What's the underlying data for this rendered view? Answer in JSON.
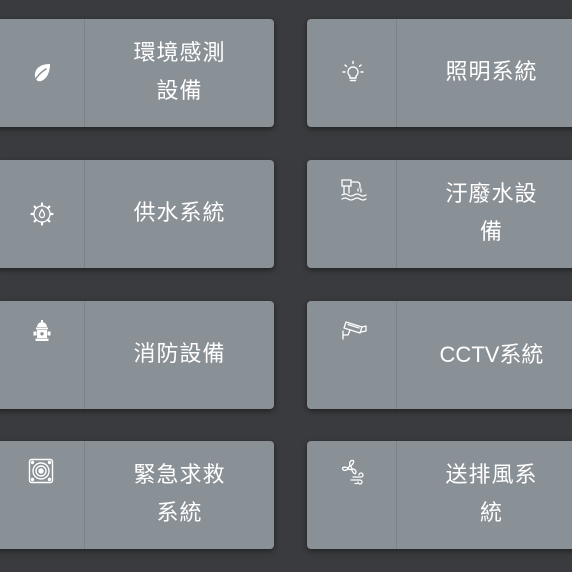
{
  "tiles": [
    {
      "id": "env",
      "label": "環境感測\n設備",
      "icon": "leaf-icon"
    },
    {
      "id": "light",
      "label": "照明系統",
      "icon": "lightbulb-icon"
    },
    {
      "id": "water",
      "label": "供水系統",
      "icon": "water-gear-icon"
    },
    {
      "id": "sewage",
      "label": "汙廢水設\n備",
      "icon": "sewage-pipe-icon"
    },
    {
      "id": "fire",
      "label": "消防設備",
      "icon": "fire-hydrant-icon"
    },
    {
      "id": "cctv",
      "label": "CCTV系統",
      "icon": "cctv-camera-icon"
    },
    {
      "id": "emerg",
      "label": "緊急求救\n系統",
      "icon": "emergency-speaker-icon"
    },
    {
      "id": "vent",
      "label": "送排風系\n統",
      "icon": "ventilation-fan-icon"
    }
  ]
}
